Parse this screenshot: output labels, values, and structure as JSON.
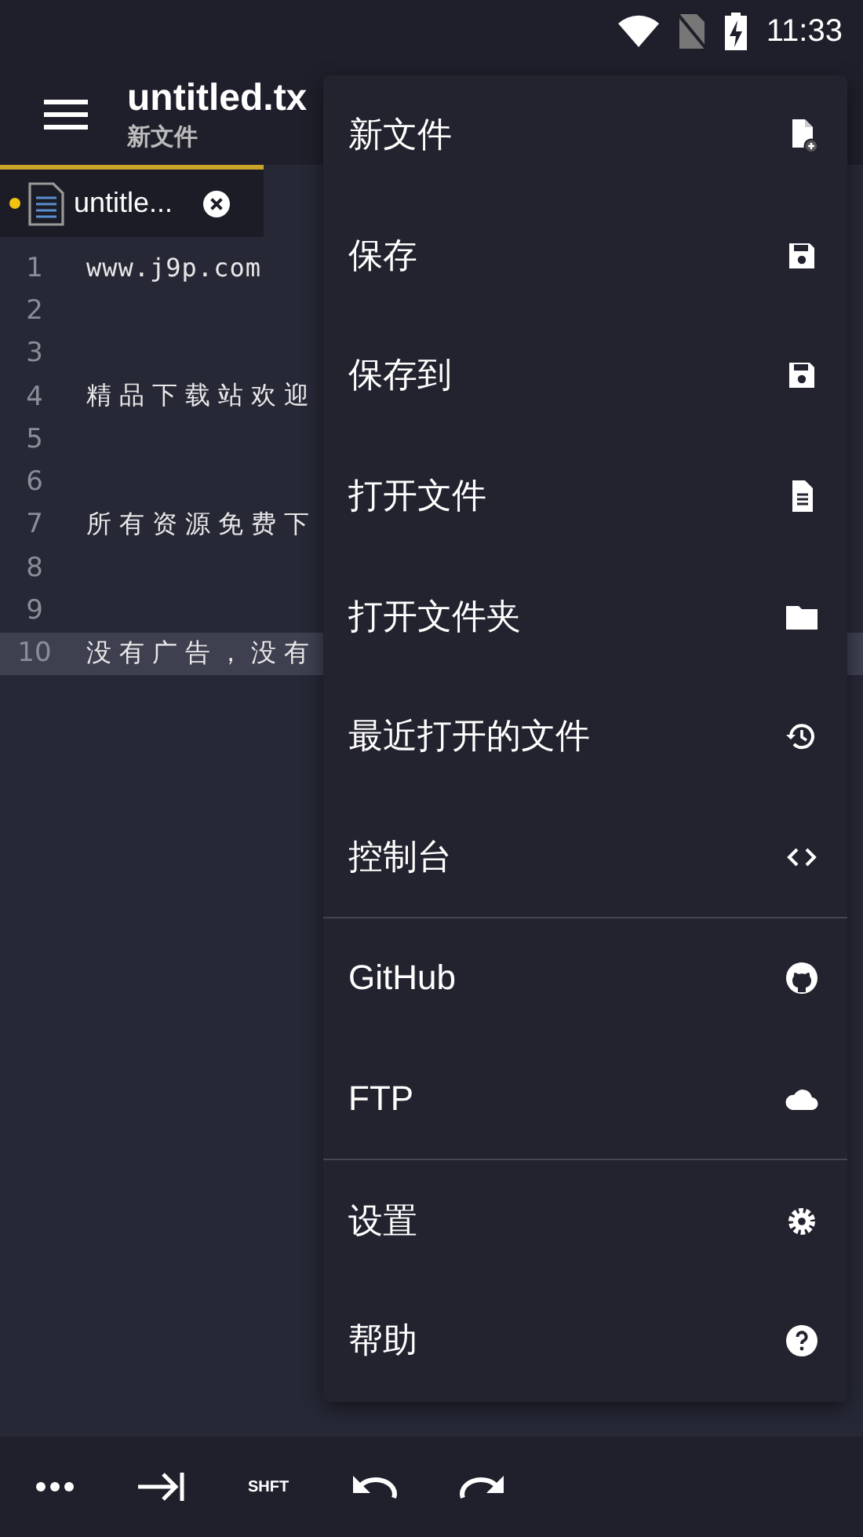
{
  "status_bar": {
    "time": "11:33"
  },
  "app_bar": {
    "title": "untitled.tx",
    "subtitle": "新文件"
  },
  "tabs": [
    {
      "label": "untitle...",
      "modified": true,
      "selected": true
    }
  ],
  "editor": {
    "lines": [
      {
        "number": "1",
        "text": "www.j9p.com",
        "current": false
      },
      {
        "number": "2",
        "current": false
      },
      {
        "number": "3",
        "current": false
      },
      {
        "number": "4",
        "text": "精品下载站欢迎",
        "current": false
      },
      {
        "number": "5",
        "current": false
      },
      {
        "number": "6",
        "current": false
      },
      {
        "number": "7",
        "text": "所有资源免费下",
        "current": false
      },
      {
        "number": "8",
        "current": false
      },
      {
        "number": "9",
        "current": false
      },
      {
        "number": "10",
        "text": "没有广告，没有",
        "current": true
      }
    ]
  },
  "menu": {
    "groups": [
      [
        {
          "label": "新文件"
        },
        {
          "label": "保存"
        },
        {
          "label": "保存到"
        },
        {
          "label": "打开文件"
        },
        {
          "label": "打开文件夹"
        },
        {
          "label": "最近打开的文件"
        },
        {
          "label": "控制台"
        }
      ],
      [
        {
          "label": "GitHub"
        },
        {
          "label": "FTP"
        }
      ],
      [
        {
          "label": "设置"
        },
        {
          "label": "帮助"
        }
      ]
    ]
  },
  "key_bar": {
    "keys": [
      {
        "kind": "more"
      },
      {
        "kind": "tab"
      },
      {
        "kind": "text",
        "label": "SHFT"
      },
      {
        "kind": "undo"
      },
      {
        "kind": "redo"
      }
    ]
  }
}
